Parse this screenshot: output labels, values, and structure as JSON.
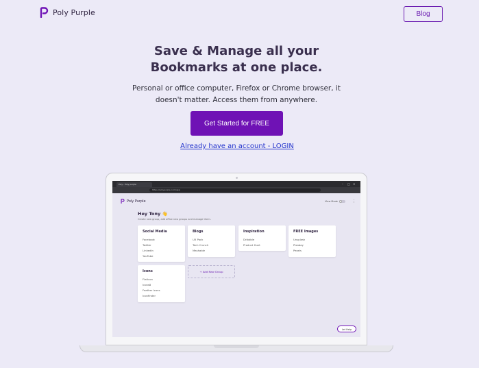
{
  "header": {
    "brand_name": "Poly Purple",
    "blog_label": "Blog"
  },
  "hero": {
    "title_line1": "Save & Manage all your",
    "title_line2": "Bookmarks at one place.",
    "subtitle_line1": "Personal or office computer, Firefox or Chrome browser, it",
    "subtitle_line2": "doesn't matter. Access them from anywhere.",
    "cta_label": "Get Started for FREE",
    "login_label": "Already have an account - LOGIN"
  },
  "colors": {
    "background": "#eceaf7",
    "brand_purple": "#6f12b5",
    "heading": "#3a2f4e",
    "link": "#2233cc"
  },
  "preview": {
    "tab_title": "Poly - Poly purple",
    "url": "https://polypurple.com/app",
    "brand_name": "Poly Purple",
    "view_mode_label": "View Mode",
    "greeting": "Hey Tony 👋",
    "greeting_sub": "Create new group, add office new groups and manage them.",
    "groups": [
      {
        "title": "Social Media",
        "items": [
          "Facebook",
          "Twitter",
          "LinkedIn",
          "YouTube"
        ]
      },
      {
        "title": "Blogs",
        "items": [
          "UX Pack",
          "Tech Crunch",
          "Mashable"
        ]
      },
      {
        "title": "Inspiration",
        "items": [
          "Dribbble",
          "Product Hunt"
        ]
      },
      {
        "title": "FREE Images",
        "items": [
          "Unsplash",
          "Pixabay",
          "Pexels"
        ]
      },
      {
        "title": "Icons",
        "items": [
          "Flaticon",
          "Icons8",
          "Feather Icons",
          "Iconfinder"
        ]
      }
    ],
    "add_group_label": "+ Add New Group",
    "help_label": "Let Help"
  }
}
